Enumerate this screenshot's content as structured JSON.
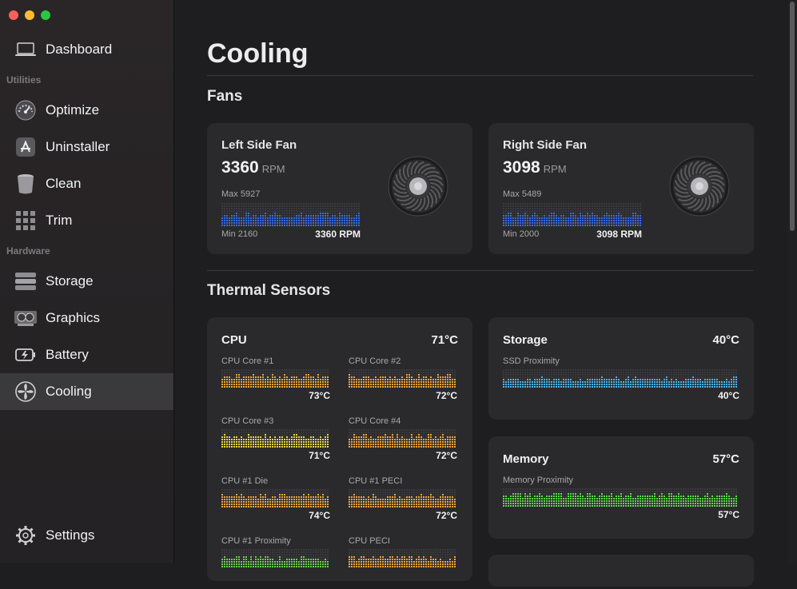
{
  "sidebar": {
    "dashboard": {
      "label": "Dashboard",
      "icon": "laptop-icon"
    },
    "utilities_label": "Utilities",
    "optimize": {
      "label": "Optimize",
      "icon": "speedometer-icon"
    },
    "uninstaller": {
      "label": "Uninstaller",
      "icon": "app-store-icon"
    },
    "clean": {
      "label": "Clean",
      "icon": "trash-icon"
    },
    "trim": {
      "label": "Trim",
      "icon": "grid-icon"
    },
    "hardware_label": "Hardware",
    "storage": {
      "label": "Storage",
      "icon": "drive-icon"
    },
    "graphics": {
      "label": "Graphics",
      "icon": "gpu-icon"
    },
    "battery": {
      "label": "Battery",
      "icon": "battery-icon"
    },
    "cooling": {
      "label": "Cooling",
      "icon": "fan-icon",
      "active": true
    },
    "settings": {
      "label": "Settings",
      "icon": "gear-icon"
    }
  },
  "page": {
    "title": "Cooling"
  },
  "fans": {
    "section_title": "Fans",
    "unit": "RPM",
    "items": [
      {
        "name": "Left Side Fan",
        "rpm": "3360",
        "max": "Max 5927",
        "min": "Min 2160",
        "current": "3360 RPM",
        "fill": 0.5
      },
      {
        "name": "Right Side Fan",
        "rpm": "3098",
        "max": "Max 5489",
        "min": "Min 2000",
        "current": "3098 RPM",
        "fill": 0.5
      }
    ]
  },
  "thermal": {
    "section_title": "Thermal Sensors",
    "cpu": {
      "title": "CPU",
      "temp": "71°C",
      "sensors": [
        {
          "name": "CPU Core #1",
          "temp": "73°C",
          "color": "#f0a53a",
          "fill": 0.62
        },
        {
          "name": "CPU Core #2",
          "temp": "72°C",
          "color": "#f0a53a",
          "fill": 0.6
        },
        {
          "name": "CPU Core #3",
          "temp": "71°C",
          "color": "#e4d84a",
          "fill": 0.6
        },
        {
          "name": "CPU Core #4",
          "temp": "72°C",
          "color": "#f0a53a",
          "fill": 0.62
        },
        {
          "name": "CPU #1 Die",
          "temp": "74°C",
          "color": "#f0a53a",
          "fill": 0.66
        },
        {
          "name": "CPU #1 PECI",
          "temp": "72°C",
          "color": "#f0a53a",
          "fill": 0.6
        },
        {
          "name": "CPU #1 Proximity",
          "temp": "",
          "color": "#6ccf4e",
          "fill": 0.5
        },
        {
          "name": "CPU PECI",
          "temp": "",
          "color": "#f0a53a",
          "fill": 0.5
        }
      ]
    },
    "storage": {
      "title": "Storage",
      "temp": "40°C",
      "sensor_name": "SSD Proximity",
      "sensor_temp": "40°C",
      "color": "#4ab4ec",
      "fill": 0.45
    },
    "memory": {
      "title": "Memory",
      "temp": "57°C",
      "sensor_name": "Memory Proximity",
      "sensor_temp": "57°C",
      "color": "#5ed84a",
      "fill": 0.62
    }
  },
  "colors": {
    "fan_bar": "#3a6ae0",
    "accent_bg": "#2a2a2d"
  }
}
